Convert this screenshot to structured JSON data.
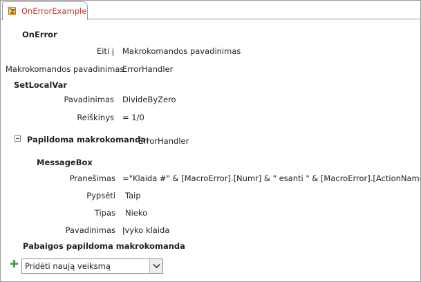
{
  "tab": {
    "title": "OnErrorExample",
    "icon": "macro-icon"
  },
  "on_error": {
    "name": "OnError",
    "goto_label": "Eiti į",
    "goto_value": "Makrokomandos pavadinimas",
    "macro_name_label": "Makrokomandos pavadinimas",
    "macro_name_value": "ErrorHandler"
  },
  "set_local_var": {
    "name": "SetLocalVar",
    "name_label": "Pavadinimas",
    "name_value": "DivideByZero",
    "expr_label": "Reiškinys",
    "expr_value": "= 1/0"
  },
  "submacro": {
    "header_label": "Papildoma makrokomanda:",
    "header_value": "ErrorHandler",
    "collapse_icon": "minus-box-icon",
    "message_box": {
      "name": "MessageBox",
      "message_label": "Pranešimas",
      "message_value": "=\"Klaida #\" & [MacroError].[Numr] & \" esanti \" & [MacroError].[ActionName] & \"v",
      "beep_label": "Pypsėti",
      "beep_value": "Taip",
      "type_label": "Tipas",
      "type_value": "Nieko",
      "title_label": "Pavadinimas",
      "title_value": "Įvyko klaida"
    },
    "end_label": "Pabaigos papildoma makrokomanda"
  },
  "add_action": {
    "value": "Pridėti naują veiksmą",
    "icon": "plus-icon",
    "dropdown_icon": "chevron-down-icon"
  },
  "colors": {
    "tab_text": "#c0392b",
    "plus": "#4aa34a",
    "border": "#9a9a9a"
  }
}
